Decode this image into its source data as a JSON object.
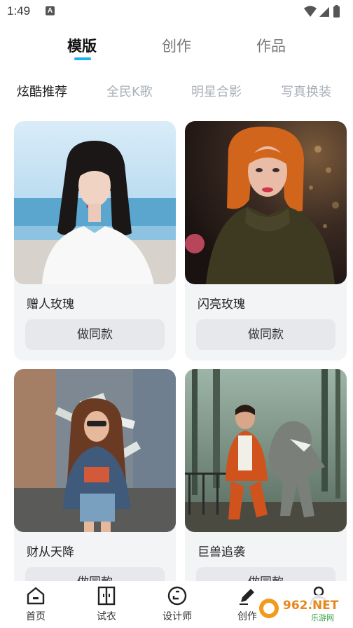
{
  "status_bar": {
    "time": "1:49",
    "notif_glyph": "A"
  },
  "top_tabs": [
    {
      "label": "模版",
      "active": true
    },
    {
      "label": "创作",
      "active": false
    },
    {
      "label": "作品",
      "active": false
    }
  ],
  "sub_tabs": [
    {
      "label": "炫酷推荐",
      "active": true
    },
    {
      "label": "全民K歌",
      "active": false
    },
    {
      "label": "明星合影",
      "active": false
    },
    {
      "label": "写真换装",
      "active": false
    }
  ],
  "cards": [
    {
      "title": "赠人玫瑰",
      "button": "做同款",
      "image": "woman-beach-photo"
    },
    {
      "title": "闪亮玫瑰",
      "button": "做同款",
      "image": "redhead-woman-photo"
    },
    {
      "title": "财从天降",
      "button": "做同款",
      "image": "money-rain-girl-photo"
    },
    {
      "title": "巨兽追袭",
      "button": "做同款",
      "image": "dinosaur-chase-photo"
    }
  ],
  "bottom_nav": [
    {
      "label": "首页",
      "icon": "home-icon"
    },
    {
      "label": "试衣",
      "icon": "wardrobe-icon"
    },
    {
      "label": "设计师",
      "icon": "designer-icon"
    },
    {
      "label": "创作",
      "icon": "pen-icon"
    },
    {
      "label": "",
      "icon": "profile-icon"
    }
  ],
  "watermark": {
    "text": "962.NET",
    "subtext": "乐游网"
  },
  "colors": {
    "accent": "#1fb1ec",
    "card_bg": "#f3f4f6",
    "button_bg": "#e6e8ec"
  }
}
